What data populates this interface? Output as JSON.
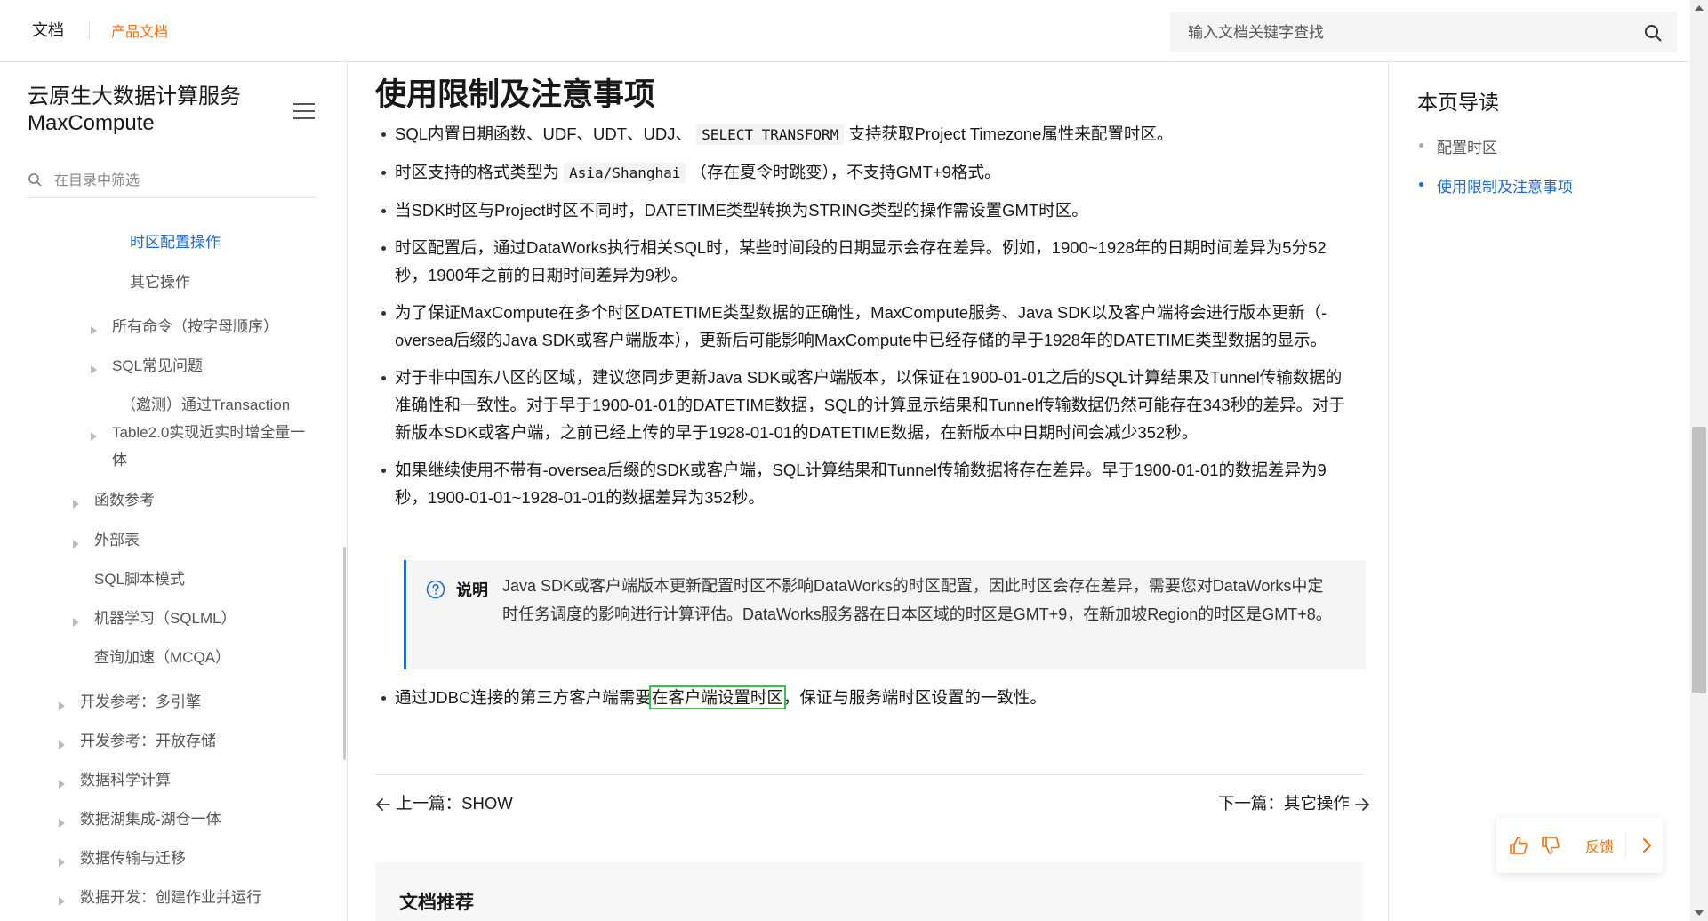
{
  "topbar": {
    "docs_label": "文档",
    "product_docs_label": "产品文档",
    "search_placeholder": "输入文档关键字查找",
    "search_icon": "search-icon"
  },
  "sidebar": {
    "title": "云原生大数据计算服务 MaxCompute",
    "menu_icon": "hamburger-menu-icon",
    "filter_placeholder": "在目录中筛选",
    "items": [
      {
        "label": "时区配置操作",
        "active": true,
        "arrow": false
      },
      {
        "label": "其它操作",
        "active": false,
        "arrow": false
      },
      {
        "label": "所有命令（按字母顺序）",
        "active": false,
        "arrow": true
      },
      {
        "label": "SQL常见问题",
        "active": false,
        "arrow": true
      },
      {
        "label": "（邀测）通过Transaction Table2.0实现近实时增全量一体",
        "active": false,
        "arrow": true
      },
      {
        "label": "函数参考",
        "active": false,
        "arrow": true
      },
      {
        "label": "外部表",
        "active": false,
        "arrow": true
      },
      {
        "label": "SQL脚本模式",
        "active": false,
        "arrow": false
      },
      {
        "label": "机器学习（SQLML）",
        "active": false,
        "arrow": true
      },
      {
        "label": "查询加速（MCQA）",
        "active": false,
        "arrow": false
      },
      {
        "label": "开发参考：多引擎",
        "active": false,
        "arrow": true
      },
      {
        "label": "开发参考：开放存储",
        "active": false,
        "arrow": true
      },
      {
        "label": "数据科学计算",
        "active": false,
        "arrow": true
      },
      {
        "label": "数据湖集成-湖仓一体",
        "active": false,
        "arrow": true
      },
      {
        "label": "数据传输与迁移",
        "active": false,
        "arrow": true
      },
      {
        "label": "数据开发：创建作业并运行",
        "active": false,
        "arrow": true
      }
    ]
  },
  "main": {
    "page_title": "使用限制及注意事项",
    "bullets": [
      {
        "before": "SQL内置日期函数、UDF、UDT、UDJ、",
        "code": "SELECT TRANSFORM",
        "after": "支持获取Project Timezone属性来配置时区。"
      },
      {
        "before": "时区支持的格式类型为",
        "code": "Asia/Shanghai",
        "after": "（存在夏令时跳变），不支持GMT+9格式。"
      },
      {
        "before": "当SDK时区与Project时区不同时，DATETIME类型转换为STRING类型的操作需设置GMT时区。",
        "code": "",
        "after": ""
      },
      {
        "before": "时区配置后，通过DataWorks执行相关SQL时，某些时间段的日期显示会存在差异。例如，1900~1928年的日期时间差异为5分52秒，1900年之前的日期时间差异为9秒。",
        "code": "",
        "after": ""
      },
      {
        "before": "为了保证MaxCompute在多个时区DATETIME类型数据的正确性，MaxCompute服务、Java SDK以及客户端将会进行版本更新（-oversea后缀的Java SDK或客户端版本），更新后可能影响MaxCompute中已经存储的早于1928年的DATETIME类型数据的显示。",
        "code": "",
        "after": ""
      },
      {
        "before": "对于非中国东八区的区域，建议您同步更新Java SDK或客户端版本，以保证在1900-01-01之后的SQL计算结果及Tunnel传输数据的准确性和一致性。对于早于1900-01-01的DATETIME数据，SQL的计算显示结果和Tunnel传输数据仍然可能存在343秒的差异。对于新版本SDK或客户端，之前已经上传的早于1928-01-01的DATETIME数据，在新版本中日期时间会减少352秒。",
        "code": "",
        "after": ""
      },
      {
        "before": "如果继续使用不带有-oversea后缀的SDK或客户端，SQL计算结果和Tunnel传输数据将存在差异。早于1900-01-01的数据差异为9秒，1900-01-01~1928-01-01的数据差异为352秒。",
        "code": "",
        "after": ""
      }
    ],
    "note": {
      "icon": "question-circle-icon",
      "label": "说明",
      "text": "Java SDK或客户端版本更新配置时区不影响DataWorks的时区配置，因此时区会存在差异，需要您对DataWorks中定时任务调度的影响进行计算评估。DataWorks服务器在日本区域的时区是GMT+9，在新加坡Region的时区是GMT+8。"
    },
    "last_bullet": {
      "before": "通过JDBC连接的第三方客户端需要",
      "highlight": "在客户端设置时区",
      "after": "，保证与服务端时区设置的一致性。"
    },
    "prev_link": "上一篇：SHOW",
    "next_link": "下一篇：其它操作",
    "recommend_title": "文档推荐"
  },
  "toc": {
    "title": "本页导读",
    "items": [
      {
        "label": "配置时区",
        "active": false
      },
      {
        "label": "使用限制及注意事项",
        "active": true
      }
    ]
  },
  "feedback": {
    "label": "反馈",
    "like_icon": "thumbs-up-icon",
    "dislike_icon": "thumbs-down-icon",
    "expand_icon": "chevron-right-icon"
  },
  "colors": {
    "accent_orange": "#ff6a00",
    "link_blue": "#1a6ae0",
    "highlight_green": "#3cc04a"
  }
}
